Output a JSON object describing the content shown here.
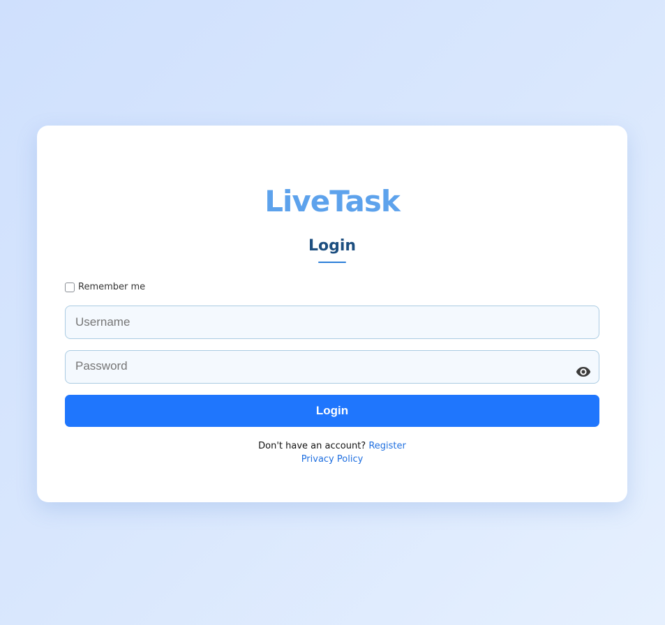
{
  "brand": {
    "name": "LiveTask"
  },
  "form": {
    "heading": "Login",
    "remember_label": "Remember me",
    "username_placeholder": "Username",
    "password_placeholder": "Password",
    "submit_label": "Login"
  },
  "footer": {
    "no_account_text": "Don't have an account?",
    "register_link": "Register",
    "privacy_link": "Privacy Policy"
  },
  "icons": {
    "password_toggle": "eye-icon"
  },
  "colors": {
    "brand": "#5da2ec",
    "heading": "#1d4f80",
    "primary_button": "#1f76fd",
    "link": "#1f6fe0"
  }
}
